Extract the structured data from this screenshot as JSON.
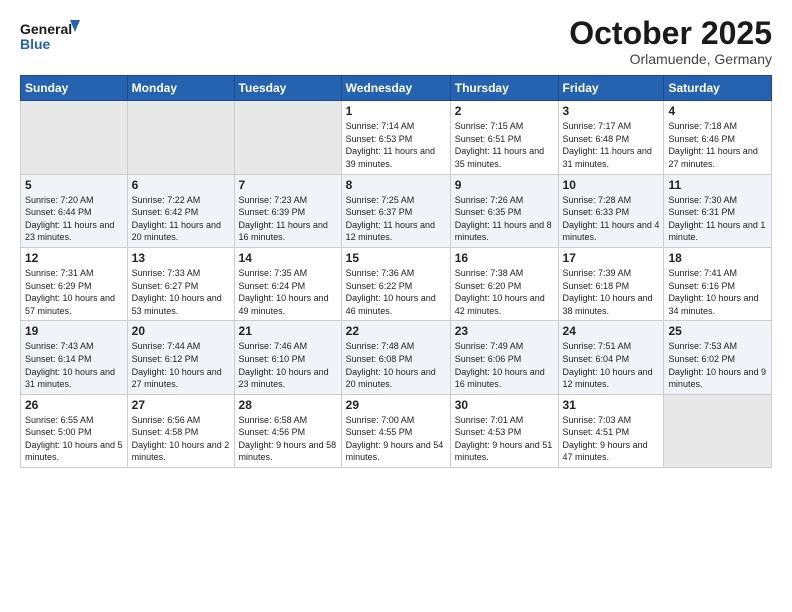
{
  "header": {
    "logo_line1": "General",
    "logo_line2": "Blue",
    "month": "October 2025",
    "location": "Orlamuende, Germany"
  },
  "weekdays": [
    "Sunday",
    "Monday",
    "Tuesday",
    "Wednesday",
    "Thursday",
    "Friday",
    "Saturday"
  ],
  "weeks": [
    [
      {
        "day": "",
        "sunrise": "",
        "sunset": "",
        "daylight": "",
        "empty": true
      },
      {
        "day": "",
        "sunrise": "",
        "sunset": "",
        "daylight": "",
        "empty": true
      },
      {
        "day": "",
        "sunrise": "",
        "sunset": "",
        "daylight": "",
        "empty": true
      },
      {
        "day": "1",
        "sunrise": "Sunrise: 7:14 AM",
        "sunset": "Sunset: 6:53 PM",
        "daylight": "Daylight: 11 hours and 39 minutes."
      },
      {
        "day": "2",
        "sunrise": "Sunrise: 7:15 AM",
        "sunset": "Sunset: 6:51 PM",
        "daylight": "Daylight: 11 hours and 35 minutes."
      },
      {
        "day": "3",
        "sunrise": "Sunrise: 7:17 AM",
        "sunset": "Sunset: 6:48 PM",
        "daylight": "Daylight: 11 hours and 31 minutes."
      },
      {
        "day": "4",
        "sunrise": "Sunrise: 7:18 AM",
        "sunset": "Sunset: 6:46 PM",
        "daylight": "Daylight: 11 hours and 27 minutes."
      }
    ],
    [
      {
        "day": "5",
        "sunrise": "Sunrise: 7:20 AM",
        "sunset": "Sunset: 6:44 PM",
        "daylight": "Daylight: 11 hours and 23 minutes."
      },
      {
        "day": "6",
        "sunrise": "Sunrise: 7:22 AM",
        "sunset": "Sunset: 6:42 PM",
        "daylight": "Daylight: 11 hours and 20 minutes."
      },
      {
        "day": "7",
        "sunrise": "Sunrise: 7:23 AM",
        "sunset": "Sunset: 6:39 PM",
        "daylight": "Daylight: 11 hours and 16 minutes."
      },
      {
        "day": "8",
        "sunrise": "Sunrise: 7:25 AM",
        "sunset": "Sunset: 6:37 PM",
        "daylight": "Daylight: 11 hours and 12 minutes."
      },
      {
        "day": "9",
        "sunrise": "Sunrise: 7:26 AM",
        "sunset": "Sunset: 6:35 PM",
        "daylight": "Daylight: 11 hours and 8 minutes."
      },
      {
        "day": "10",
        "sunrise": "Sunrise: 7:28 AM",
        "sunset": "Sunset: 6:33 PM",
        "daylight": "Daylight: 11 hours and 4 minutes."
      },
      {
        "day": "11",
        "sunrise": "Sunrise: 7:30 AM",
        "sunset": "Sunset: 6:31 PM",
        "daylight": "Daylight: 11 hours and 1 minute."
      }
    ],
    [
      {
        "day": "12",
        "sunrise": "Sunrise: 7:31 AM",
        "sunset": "Sunset: 6:29 PM",
        "daylight": "Daylight: 10 hours and 57 minutes."
      },
      {
        "day": "13",
        "sunrise": "Sunrise: 7:33 AM",
        "sunset": "Sunset: 6:27 PM",
        "daylight": "Daylight: 10 hours and 53 minutes."
      },
      {
        "day": "14",
        "sunrise": "Sunrise: 7:35 AM",
        "sunset": "Sunset: 6:24 PM",
        "daylight": "Daylight: 10 hours and 49 minutes."
      },
      {
        "day": "15",
        "sunrise": "Sunrise: 7:36 AM",
        "sunset": "Sunset: 6:22 PM",
        "daylight": "Daylight: 10 hours and 46 minutes."
      },
      {
        "day": "16",
        "sunrise": "Sunrise: 7:38 AM",
        "sunset": "Sunset: 6:20 PM",
        "daylight": "Daylight: 10 hours and 42 minutes."
      },
      {
        "day": "17",
        "sunrise": "Sunrise: 7:39 AM",
        "sunset": "Sunset: 6:18 PM",
        "daylight": "Daylight: 10 hours and 38 minutes."
      },
      {
        "day": "18",
        "sunrise": "Sunrise: 7:41 AM",
        "sunset": "Sunset: 6:16 PM",
        "daylight": "Daylight: 10 hours and 34 minutes."
      }
    ],
    [
      {
        "day": "19",
        "sunrise": "Sunrise: 7:43 AM",
        "sunset": "Sunset: 6:14 PM",
        "daylight": "Daylight: 10 hours and 31 minutes."
      },
      {
        "day": "20",
        "sunrise": "Sunrise: 7:44 AM",
        "sunset": "Sunset: 6:12 PM",
        "daylight": "Daylight: 10 hours and 27 minutes."
      },
      {
        "day": "21",
        "sunrise": "Sunrise: 7:46 AM",
        "sunset": "Sunset: 6:10 PM",
        "daylight": "Daylight: 10 hours and 23 minutes."
      },
      {
        "day": "22",
        "sunrise": "Sunrise: 7:48 AM",
        "sunset": "Sunset: 6:08 PM",
        "daylight": "Daylight: 10 hours and 20 minutes."
      },
      {
        "day": "23",
        "sunrise": "Sunrise: 7:49 AM",
        "sunset": "Sunset: 6:06 PM",
        "daylight": "Daylight: 10 hours and 16 minutes."
      },
      {
        "day": "24",
        "sunrise": "Sunrise: 7:51 AM",
        "sunset": "Sunset: 6:04 PM",
        "daylight": "Daylight: 10 hours and 12 minutes."
      },
      {
        "day": "25",
        "sunrise": "Sunrise: 7:53 AM",
        "sunset": "Sunset: 6:02 PM",
        "daylight": "Daylight: 10 hours and 9 minutes."
      }
    ],
    [
      {
        "day": "26",
        "sunrise": "Sunrise: 6:55 AM",
        "sunset": "Sunset: 5:00 PM",
        "daylight": "Daylight: 10 hours and 5 minutes."
      },
      {
        "day": "27",
        "sunrise": "Sunrise: 6:56 AM",
        "sunset": "Sunset: 4:58 PM",
        "daylight": "Daylight: 10 hours and 2 minutes."
      },
      {
        "day": "28",
        "sunrise": "Sunrise: 6:58 AM",
        "sunset": "Sunset: 4:56 PM",
        "daylight": "Daylight: 9 hours and 58 minutes."
      },
      {
        "day": "29",
        "sunrise": "Sunrise: 7:00 AM",
        "sunset": "Sunset: 4:55 PM",
        "daylight": "Daylight: 9 hours and 54 minutes."
      },
      {
        "day": "30",
        "sunrise": "Sunrise: 7:01 AM",
        "sunset": "Sunset: 4:53 PM",
        "daylight": "Daylight: 9 hours and 51 minutes."
      },
      {
        "day": "31",
        "sunrise": "Sunrise: 7:03 AM",
        "sunset": "Sunset: 4:51 PM",
        "daylight": "Daylight: 9 hours and 47 minutes."
      },
      {
        "day": "",
        "sunrise": "",
        "sunset": "",
        "daylight": "",
        "empty": true
      }
    ]
  ]
}
